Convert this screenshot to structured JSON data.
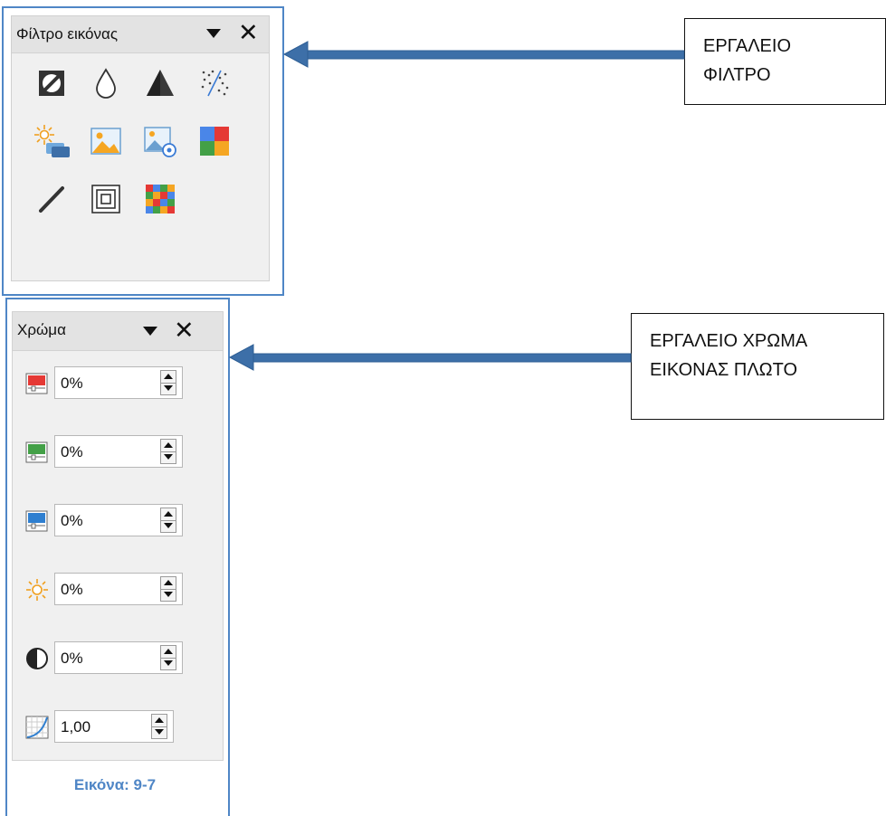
{
  "filter_toolbar": {
    "title": "Φίλτρο εικόνας",
    "tools": [
      {
        "icon": "invert-icon"
      },
      {
        "icon": "smooth-drop-icon"
      },
      {
        "icon": "sharpen-triangle-icon"
      },
      {
        "icon": "remove-noise-icon"
      },
      {
        "icon": "solarization-icon"
      },
      {
        "icon": "aging-icon"
      },
      {
        "icon": "posterize-icon"
      },
      {
        "icon": "pop-art-icon"
      },
      {
        "icon": "charcoal-sketch-icon"
      },
      {
        "icon": "relief-icon"
      },
      {
        "icon": "mosaic-icon"
      }
    ]
  },
  "color_toolbar": {
    "title": "Χρώμα",
    "rows": [
      {
        "name": "red",
        "icon": "red-channel-icon",
        "value": "0%"
      },
      {
        "name": "green",
        "icon": "green-channel-icon",
        "value": "0%"
      },
      {
        "name": "blue",
        "icon": "blue-channel-icon",
        "value": "0%"
      },
      {
        "name": "brightness",
        "icon": "brightness-icon",
        "value": "0%"
      },
      {
        "name": "contrast",
        "icon": "contrast-icon",
        "value": "0%"
      },
      {
        "name": "gamma",
        "icon": "gamma-icon",
        "value": "1,00"
      }
    ]
  },
  "caption": "Εικόνα: 9-7",
  "callouts": {
    "filter": "ΕΡΓΑΛΕΙΟ\nΦΙΛΤΡΟ",
    "color": "ΕΡΓΑΛΕΙΟ ΧΡΩΜΑ\nΕΙΚΟΝΑΣ ΠΛΩΤΟ"
  },
  "colors": {
    "frame_blue": "#4f86c6",
    "arrow_blue": "#2f5f95",
    "panel_bg": "#f0f0f0",
    "title_bg": "#e3e3e3"
  }
}
